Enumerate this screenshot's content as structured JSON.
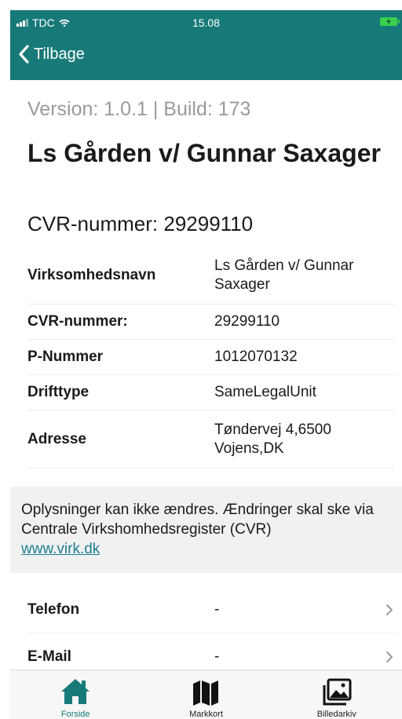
{
  "status_bar": {
    "carrier": "TDC",
    "time": "15.08"
  },
  "nav": {
    "back_label": "Tilbage"
  },
  "version_line": "Version: 1.0.1 | Build: 173",
  "company": {
    "name": "Ls Gården v/ Gunnar Saxager",
    "cvr_line": "CVR-nummer: 29299110"
  },
  "info_rows": [
    {
      "label": "Virksomhedsnavn",
      "value": "Ls Gården v/ Gunnar Saxager"
    },
    {
      "label": "CVR-nummer:",
      "value": "29299110"
    },
    {
      "label": "P-Nummer",
      "value": "1012070132"
    },
    {
      "label": "Drifttype",
      "value": "SameLegalUnit"
    },
    {
      "label": "Adresse",
      "value": "Tøndervej 4,6500 Vojens,DK"
    }
  ],
  "notice": {
    "text": "Oplysninger kan ikke ændres. Ændringer skal ske via Centrale Virkshomhedsregister (CVR)",
    "link": "www.virk.dk"
  },
  "contact_rows": [
    {
      "label": "Telefon",
      "value": "-"
    },
    {
      "label": "E-Mail",
      "value": "-"
    }
  ],
  "tabs": [
    {
      "label": "Forside",
      "icon": "home-icon",
      "active": true
    },
    {
      "label": "Markkort",
      "icon": "map-icon",
      "active": false
    },
    {
      "label": "Billedarkiv",
      "icon": "photo-archive-icon",
      "active": false
    }
  ],
  "colors": {
    "accent": "#177a78",
    "link": "#1e7f92",
    "battery": "#3ad14f"
  }
}
